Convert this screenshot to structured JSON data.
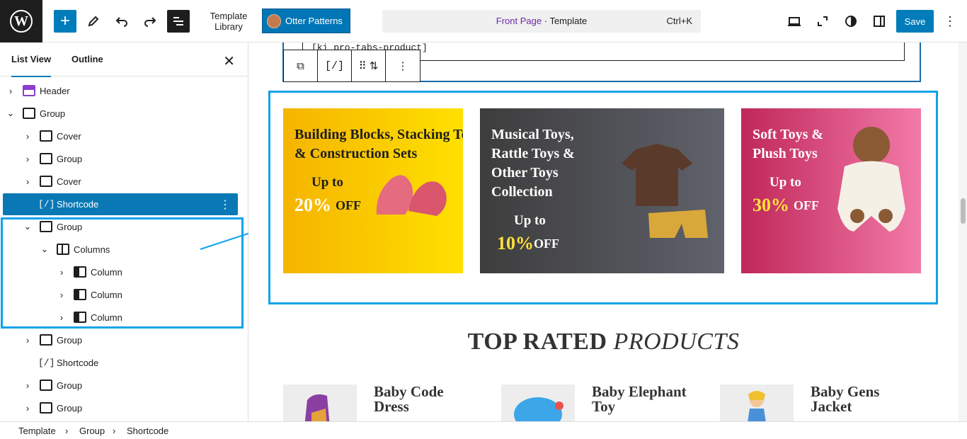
{
  "toolbar": {
    "template_library": "Template Library",
    "otter_patterns": "Otter Patterns",
    "page_name": "Front Page",
    "doc_type": "· Template",
    "shortcut": "Ctrl+K",
    "save": "Save"
  },
  "sidebar": {
    "tabs": [
      "List View",
      "Outline"
    ],
    "items": [
      {
        "label": "Header",
        "icon": "template-part-icon"
      },
      {
        "label": "Group",
        "icon": "group-icon"
      },
      {
        "label": "Cover",
        "icon": "cover-icon"
      },
      {
        "label": "Group",
        "icon": "group-icon"
      },
      {
        "label": "Cover",
        "icon": "cover-icon"
      },
      {
        "label": "Shortcode",
        "icon": "shortcode-icon"
      },
      {
        "label": "Group",
        "icon": "group-icon"
      },
      {
        "label": "Columns",
        "icon": "columns-icon"
      },
      {
        "label": "Column",
        "icon": "column-icon"
      },
      {
        "label": "Column",
        "icon": "column-icon"
      },
      {
        "label": "Column",
        "icon": "column-icon"
      },
      {
        "label": "Group",
        "icon": "group-icon"
      },
      {
        "label": "Shortcode",
        "icon": "shortcode-icon"
      },
      {
        "label": "Group",
        "icon": "group-icon"
      },
      {
        "label": "Group",
        "icon": "group-icon"
      }
    ]
  },
  "editor": {
    "shortcode_text": "[ki   pro-tabs-product]",
    "promos": [
      {
        "title_line1": "Building Blocks, Stacking To",
        "title_line2": "& Construction Sets",
        "up_to": "Up to",
        "percent": "20%",
        "off": "OFF"
      },
      {
        "title_line1": "Musical Toys,",
        "title_line2": "Rattle Toys &",
        "title_line3": "Other Toys",
        "title_line4": "Collection",
        "up_to": "Up to",
        "percent": "10%",
        "off": "OFF"
      },
      {
        "title_line1": "Soft Toys &",
        "title_line2": "Plush Toys",
        "up_to": "Up to",
        "percent": "30%",
        "off": "OFF"
      }
    ],
    "section_title": "TOP RATED",
    "section_title_italic": "PRODUCTS",
    "products": [
      {
        "name_line1": "Baby Code",
        "name_line2": "Dress"
      },
      {
        "name_line1": "Baby Elephant",
        "name_line2": "Toy"
      },
      {
        "name_line1": "Baby Gens",
        "name_line2": "Jacket"
      }
    ]
  },
  "breadcrumbs": [
    "Template",
    "Group",
    "Shortcode"
  ],
  "colors": {
    "accent": "#007cba",
    "highlight": "#10a3e8",
    "selected_row": "#0a78b5"
  }
}
